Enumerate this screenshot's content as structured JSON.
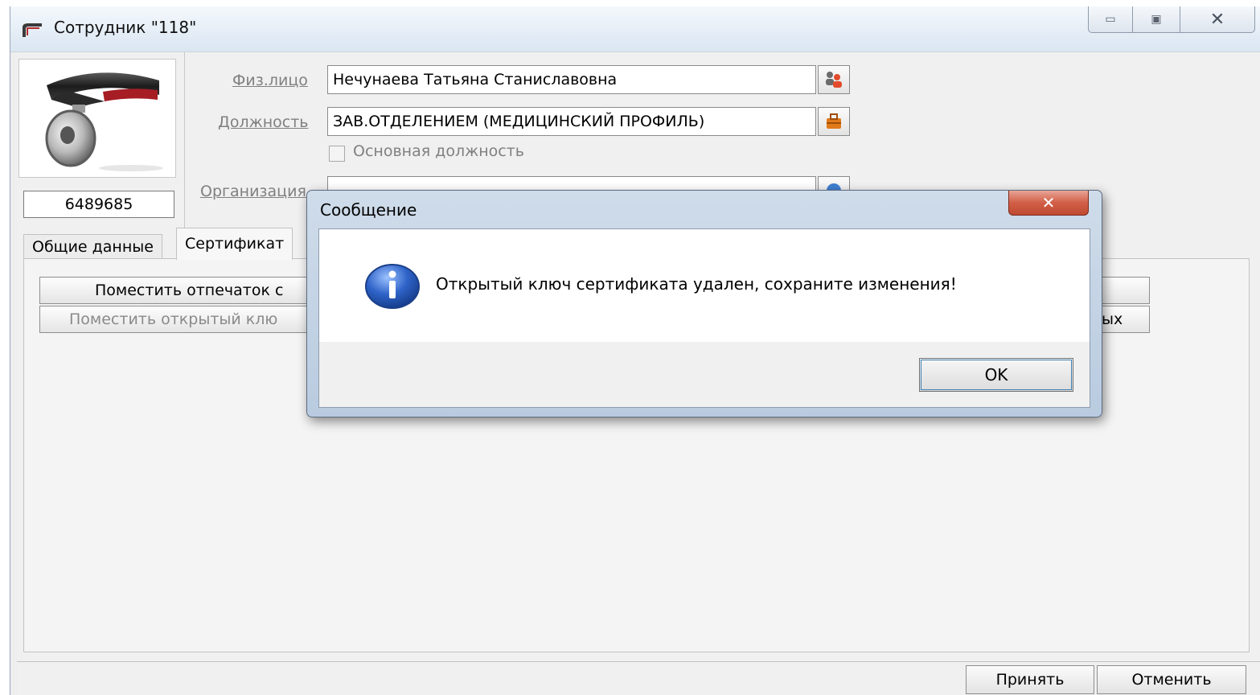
{
  "window": {
    "title": "Сотрудник \"118\"",
    "controls": {
      "minimize": "▭",
      "maximize": "▣",
      "close": "✕"
    }
  },
  "employee": {
    "id_number": "6489685",
    "photo": "head-mirror-icon"
  },
  "form": {
    "person_label": "Физ.лицо",
    "person_value": "Нечунаева Татьяна Станиславовна",
    "position_label": "Должность",
    "position_value": "ЗАВ.ОТДЕЛЕНИЕМ (МЕДИЦИНСКИЙ ПРОФИЛЬ)",
    "main_position_label": "Основная должность",
    "main_position_checked": false,
    "organization_label": "Организация",
    "organization_value": ""
  },
  "tabs": [
    {
      "label": "Общие данные",
      "active": false
    },
    {
      "label": "Сертификат",
      "active": true
    }
  ],
  "certificate_panel": {
    "place_fingerprint_button": "Поместить отпечаток с",
    "place_public_key_button": "Поместить открытый клю",
    "right_button_fragment": "ых"
  },
  "footer": {
    "accept_button": "Принять",
    "cancel_button": "Отменить"
  },
  "dialog": {
    "title": "Сообщение",
    "close": "✕",
    "message": "Открытый ключ сертификата удален, сохраните изменения!",
    "icon": "info-icon",
    "ok_button": "OK"
  },
  "colors": {
    "info_icon_blue": "#2f63c8",
    "dialog_close_red": "#c8503a",
    "window_frame": "#dbe6f2"
  }
}
